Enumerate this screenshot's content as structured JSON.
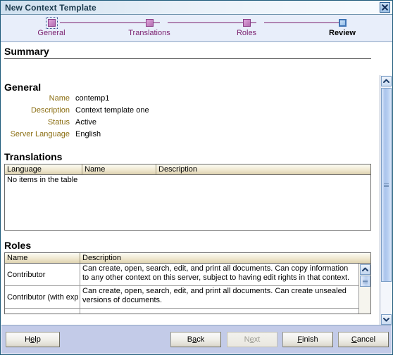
{
  "window": {
    "title": "New Context Template",
    "close_icon": "close-icon"
  },
  "wizard": {
    "steps": [
      {
        "label": "General",
        "state": "pending-focused"
      },
      {
        "label": "Translations",
        "state": "pending"
      },
      {
        "label": "Roles",
        "state": "pending"
      },
      {
        "label": "Review",
        "state": "current"
      }
    ]
  },
  "content": {
    "page_heading": "Summary",
    "general": {
      "heading": "General",
      "fields": [
        {
          "label": "Name",
          "value": "contemp1"
        },
        {
          "label": "Description",
          "value": "Context template one"
        },
        {
          "label": "Status",
          "value": "Active"
        },
        {
          "label": "Server Language",
          "value": "English"
        }
      ]
    },
    "translations": {
      "heading": "Translations",
      "columns": [
        "Language",
        "Name",
        "Description"
      ],
      "rows": [],
      "empty_text": "No items in the table"
    },
    "roles": {
      "heading": "Roles",
      "columns": [
        "Name",
        "Description"
      ],
      "rows": [
        {
          "name": "Contributor",
          "description": "Can create, open, search, edit, and print all documents. Can copy information to any other context on this server, subject to having edit rights in that context."
        },
        {
          "name": "Contributor (with exp",
          "description": "Can create, open, search, edit, and print all documents. Can create unsealed versions of documents."
        },
        {
          "name": "",
          "description": ""
        }
      ]
    }
  },
  "scrollbars": {
    "main": {
      "up_icon": "chevron-up-icon",
      "down_icon": "chevron-down-icon",
      "grip_icon": "grip-icon"
    },
    "roles": {
      "up_icon": "chevron-up-icon",
      "grip_icon": "grip-icon"
    }
  },
  "footer": {
    "buttons": [
      {
        "id": "help",
        "label": "Help",
        "pre": "H",
        "mnemonic": "e",
        "post": "lp",
        "disabled": false
      },
      {
        "id": "back",
        "label": "Back",
        "pre": "B",
        "mnemonic": "a",
        "post": "ck",
        "disabled": false
      },
      {
        "id": "next",
        "label": "Next",
        "pre": "N",
        "mnemonic": "e",
        "post": "xt",
        "disabled": true
      },
      {
        "id": "finish",
        "label": "Finish",
        "pre": "",
        "mnemonic": "F",
        "post": "inish",
        "disabled": false
      },
      {
        "id": "cancel",
        "label": "Cancel",
        "pre": "",
        "mnemonic": "C",
        "post": "ancel",
        "disabled": false
      }
    ]
  },
  "colors": {
    "accent_purple": "#7b1f6e",
    "label_olive": "#8a6d10",
    "footer_bg": "#c3cbe8",
    "dialog_border": "#1d5a7a"
  }
}
